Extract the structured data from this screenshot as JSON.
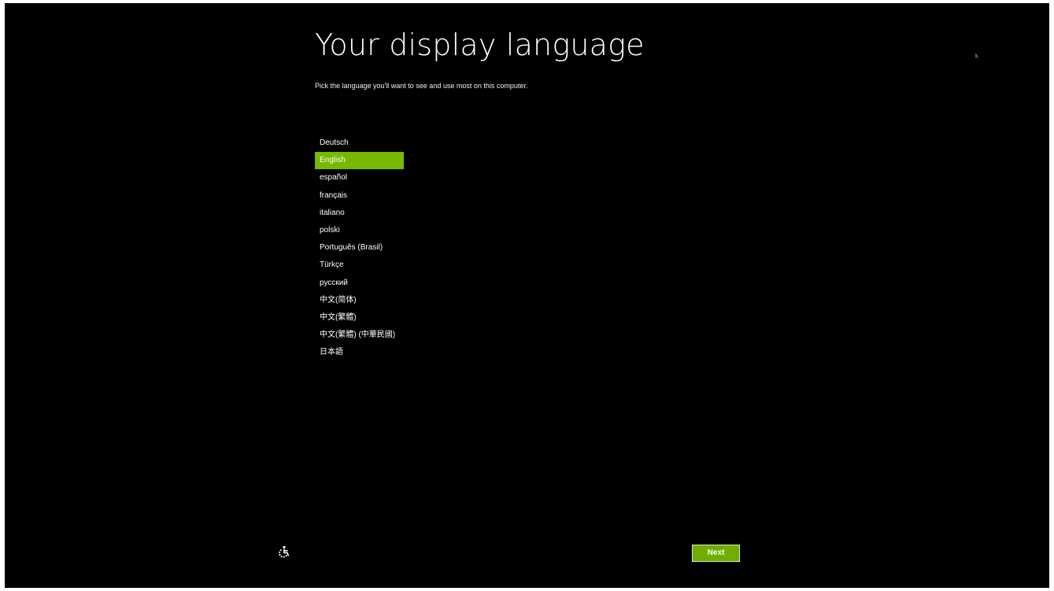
{
  "page": {
    "title": "Your display language",
    "subtitle": "Pick the language you'll want to see and use most on this computer."
  },
  "languages": [
    {
      "label": "Deutsch",
      "selected": false
    },
    {
      "label": "English",
      "selected": true
    },
    {
      "label": "español",
      "selected": false
    },
    {
      "label": "français",
      "selected": false
    },
    {
      "label": "italiano",
      "selected": false
    },
    {
      "label": "polski",
      "selected": false
    },
    {
      "label": "Português (Brasil)",
      "selected": false
    },
    {
      "label": "Türkçe",
      "selected": false
    },
    {
      "label": "русский",
      "selected": false
    },
    {
      "label": "中文(简体)",
      "selected": false
    },
    {
      "label": "中文(繁體)",
      "selected": false
    },
    {
      "label": "中文(繁體) (中華民國)",
      "selected": false
    },
    {
      "label": "日本語",
      "selected": false
    }
  ],
  "footer": {
    "accessibility_icon": "ease-of-access-icon",
    "next_label": "Next"
  },
  "colors": {
    "background": "#000000",
    "accent": "#77b800",
    "text": "#ffffff"
  }
}
